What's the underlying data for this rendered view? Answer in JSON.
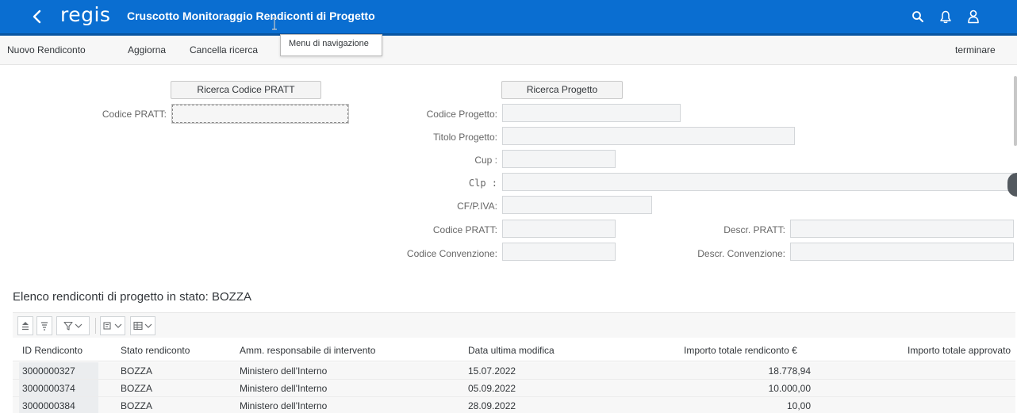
{
  "header": {
    "logo": "regis",
    "title": "Cruscotto Monitoraggio Rendiconti di Progetto"
  },
  "toolbar": {
    "new_label": "Nuovo Rendiconto",
    "refresh_label": "Aggiorna",
    "clear_label": "Cancella ricerca",
    "exit_label": "terminare",
    "tooltip": "Menu di navigazione"
  },
  "form": {
    "search_pratt_button": "Ricerca Codice PRATT",
    "search_project_button": "Ricerca Progetto",
    "codice_pratt_left": "Codice PRATT:",
    "codice_progetto": "Codice Progetto:",
    "titolo_progetto": "Titolo Progetto:",
    "cup": "Cup :",
    "clp": "Clp :",
    "cf_piva": "CF/P.IVA:",
    "codice_pratt_right": "Codice PRATT:",
    "descr_pratt": "Descr. PRATT:",
    "codice_convenzione": "Codice Convenzione:",
    "descr_convenzione": "Descr. Convenzione:"
  },
  "table": {
    "title": "Elenco rendiconti di progetto in stato: BOZZA",
    "columns": [
      "ID Rendiconto",
      "Stato rendiconto",
      "Amm. responsabile di intervento",
      "Data ultima modifica",
      "Importo totale rendiconto €",
      "Importo totale approvato"
    ],
    "rows": [
      {
        "id": "3000000327",
        "stato": "BOZZA",
        "amm": "Ministero dell'Interno",
        "data": "15.07.2022",
        "importo": "18.778,94"
      },
      {
        "id": "3000000374",
        "stato": "BOZZA",
        "amm": "Ministero dell'Interno",
        "data": "05.09.2022",
        "importo": "10.000,00"
      },
      {
        "id": "3000000384",
        "stato": "BOZZA",
        "amm": "Ministero dell'Interno",
        "data": "28.09.2022",
        "importo": "10,00"
      }
    ]
  },
  "icons": {
    "back": "chevron-left-icon",
    "search": "search-icon",
    "notifications": "bell-icon",
    "user": "user-icon"
  },
  "colors": {
    "shell": "#0a6ed1",
    "shell_dark": "#0854a0"
  }
}
